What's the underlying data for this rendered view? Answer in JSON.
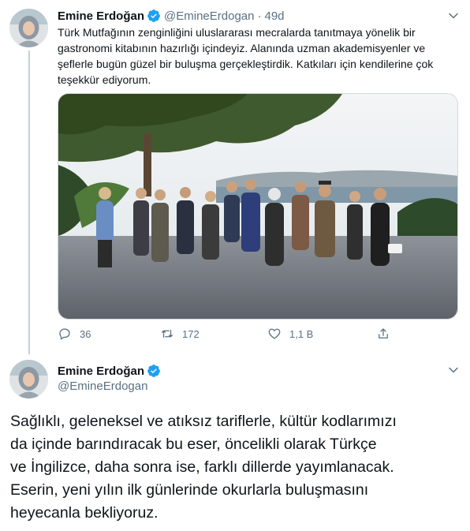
{
  "tweet1": {
    "author_name": "Emine Erdoğan",
    "handle": "@EmineErdogan",
    "separator": "·",
    "time": "49d",
    "text_lines": [
      "Türk Mutfağının zenginliğini uluslararası mecralarda tanıtmaya yönelik bir",
      "gastronomi kitabının hazırlığı içindeyiz. Alanında uzman akademisyenler ve",
      "şeflerle bugün güzel bir buluşma gerçekleştirdik. Katkıları için kendilerine çok",
      "teşekkür ediyorum."
    ],
    "replies": "36",
    "retweets": "172",
    "likes": "1,1 B"
  },
  "tweet2": {
    "author_name": "Emine Erdoğan",
    "handle": "@EmineErdogan",
    "text_lines": [
      "Sağlıklı, geleneksel ve atıksız tariflerle, kültür kodlarımızı",
      "da içinde barındıracak bu eser, öncelikli olarak Türkçe",
      "ve İngilizce, daha sonra ise, farklı dillerde yayımlanacak.",
      "Eserin, yeni yılın ilk günlerinde okurlarla buluşmasını",
      "heyecanla bekliyoruz."
    ]
  },
  "icons": {
    "verified": "verified-badge-icon",
    "more": "chevron-down-icon",
    "reply": "reply-icon",
    "retweet": "retweet-icon",
    "like": "heart-icon",
    "share": "share-icon"
  },
  "colors": {
    "verified": "#1da1f2",
    "secondary_text": "#5b7083",
    "thread_line": "#c4cfd6"
  }
}
